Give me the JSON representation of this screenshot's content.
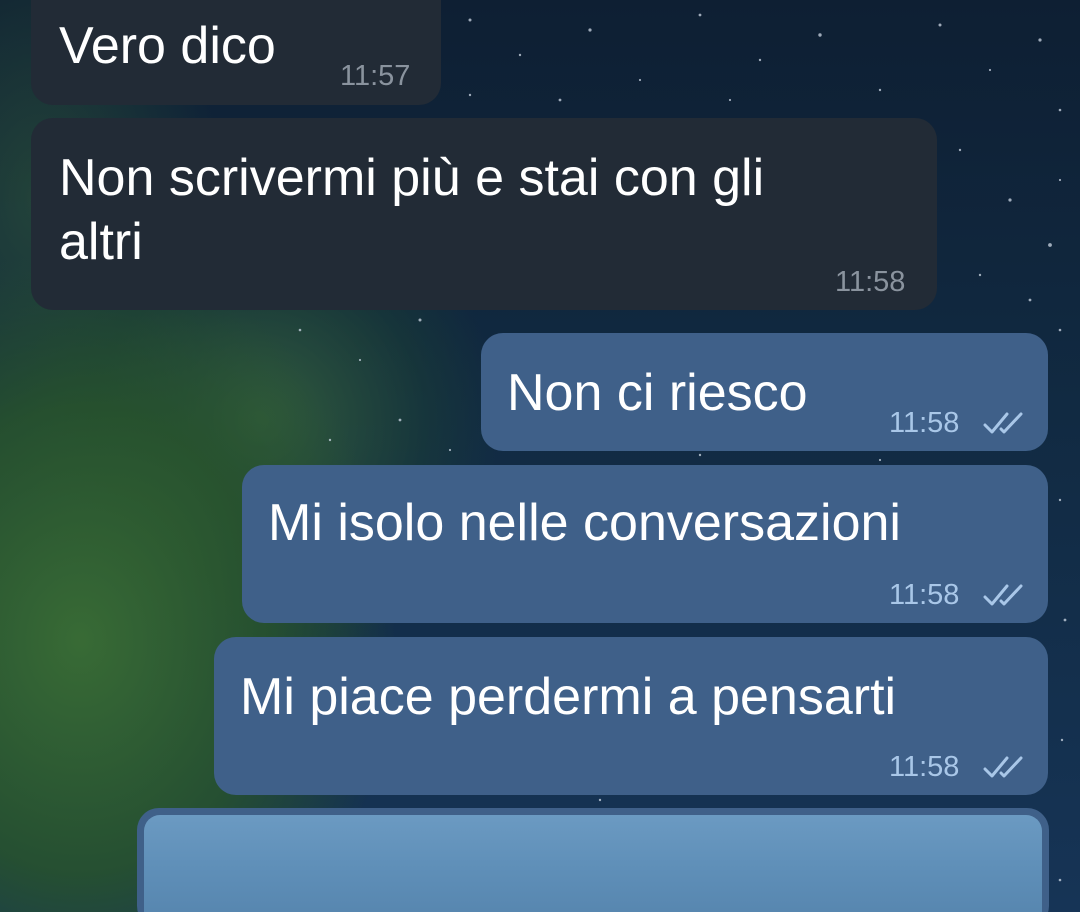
{
  "messages": [
    {
      "direction": "incoming",
      "text": "Vero dico",
      "time": "11:57"
    },
    {
      "direction": "incoming",
      "text": "Non scrivermi più e stai con gli\naltri",
      "time": "11:58"
    },
    {
      "direction": "outgoing",
      "text": "Non ci riesco",
      "time": "11:58",
      "status": "read"
    },
    {
      "direction": "outgoing",
      "text": "Mi isolo nelle conversazioni",
      "time": "11:58",
      "status": "read"
    },
    {
      "direction": "outgoing",
      "text": "Mi piace perdermi a pensarti",
      "time": "11:58",
      "status": "read"
    }
  ],
  "icons": {
    "read_receipt": "double-check-icon",
    "photo_message": "image-preview"
  },
  "colors": {
    "incoming_bubble": "#222b36",
    "outgoing_bubble": "#3f6089",
    "incoming_time": "#8a939e",
    "outgoing_time": "#a9c7e8",
    "text": "#ffffff"
  }
}
